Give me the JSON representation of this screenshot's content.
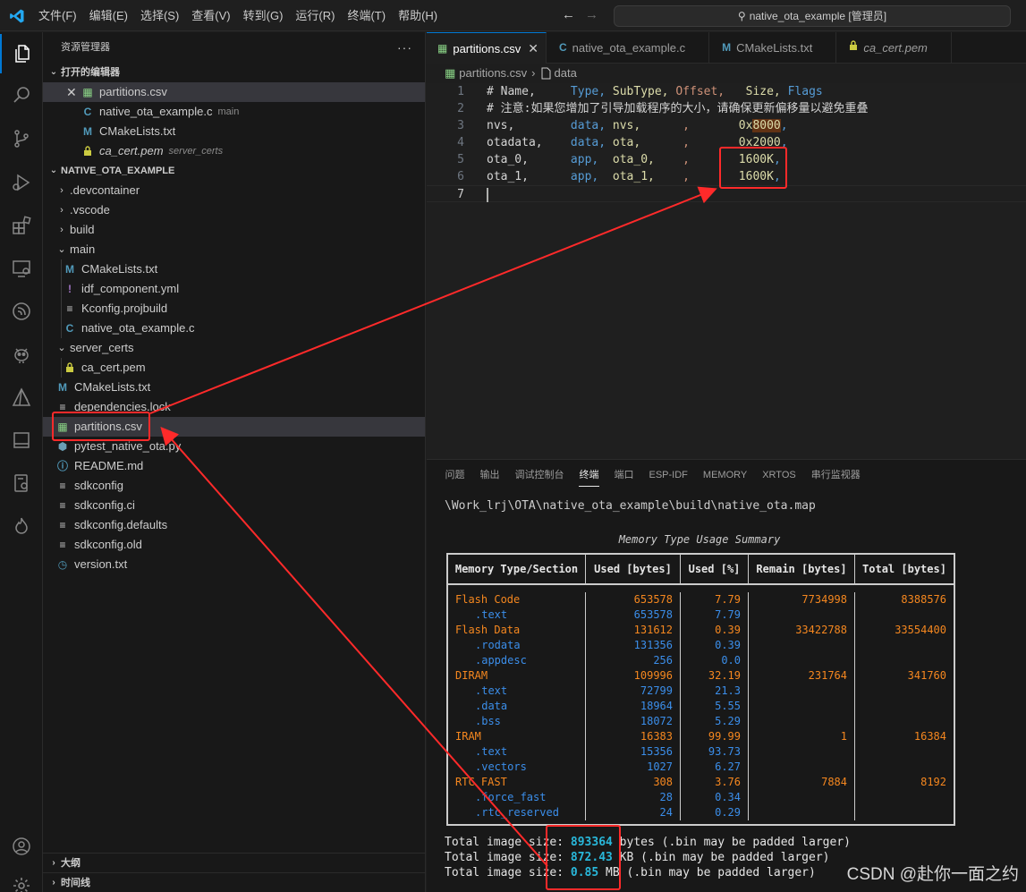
{
  "titlebar": {
    "menu": [
      "文件(F)",
      "编辑(E)",
      "选择(S)",
      "查看(V)",
      "转到(G)",
      "运行(R)",
      "终端(T)",
      "帮助(H)"
    ],
    "search_text": "native_ota_example [管理员]"
  },
  "activity_icons": [
    "explorer-icon",
    "search-icon",
    "source-control-icon",
    "run-debug-icon",
    "extensions-icon",
    "remote-explorer-icon",
    "esp-idf-icon",
    "platformio-icon",
    "cmake-icon",
    "terminal-icon",
    "device-icon",
    "flame-icon",
    "account-icon",
    "manage-icon"
  ],
  "sidebar": {
    "title": "资源管理器",
    "open_editors_title": "打开的编辑器",
    "open_editors": [
      {
        "name": "partitions.csv",
        "icon": "csv",
        "desc": ""
      },
      {
        "name": "native_ota_example.c",
        "icon": "c",
        "desc": "main"
      },
      {
        "name": "CMakeLists.txt",
        "icon": "m",
        "desc": ""
      },
      {
        "name": "ca_cert.pem",
        "icon": "lock",
        "desc": "server_certs"
      }
    ],
    "project_title": "NATIVE_OTA_EXAMPLE",
    "tree": [
      {
        "name": ".devcontainer",
        "type": "folder",
        "depth": 0,
        "expanded": false
      },
      {
        "name": ".vscode",
        "type": "folder",
        "depth": 0,
        "expanded": false
      },
      {
        "name": "build",
        "type": "folder",
        "depth": 0,
        "expanded": false
      },
      {
        "name": "main",
        "type": "folder",
        "depth": 0,
        "expanded": true
      },
      {
        "name": "CMakeLists.txt",
        "type": "m",
        "depth": 1
      },
      {
        "name": "idf_component.yml",
        "type": "excl",
        "depth": 1
      },
      {
        "name": "Kconfig.projbuild",
        "type": "lines",
        "depth": 1
      },
      {
        "name": "native_ota_example.c",
        "type": "c",
        "depth": 1
      },
      {
        "name": "server_certs",
        "type": "folder",
        "depth": 0,
        "expanded": true
      },
      {
        "name": "ca_cert.pem",
        "type": "lock",
        "depth": 1
      },
      {
        "name": "CMakeLists.txt",
        "type": "m",
        "depth": 0
      },
      {
        "name": "dependencies.lock",
        "type": "lines",
        "depth": 0
      },
      {
        "name": "partitions.csv",
        "type": "csv",
        "depth": 0,
        "selected": true
      },
      {
        "name": "pytest_native_ota.py",
        "type": "py",
        "depth": 0
      },
      {
        "name": "README.md",
        "type": "info",
        "depth": 0
      },
      {
        "name": "sdkconfig",
        "type": "lines",
        "depth": 0
      },
      {
        "name": "sdkconfig.ci",
        "type": "lines",
        "depth": 0
      },
      {
        "name": "sdkconfig.defaults",
        "type": "lines",
        "depth": 0
      },
      {
        "name": "sdkconfig.old",
        "type": "lines",
        "depth": 0
      },
      {
        "name": "version.txt",
        "type": "clock",
        "depth": 0
      }
    ],
    "outline_title": "大纲",
    "timeline_title": "时间线"
  },
  "tabs": [
    {
      "name": "partitions.csv",
      "icon": "csv",
      "active": true
    },
    {
      "name": "native_ota_example.c",
      "icon": "c"
    },
    {
      "name": "CMakeLists.txt",
      "icon": "m"
    },
    {
      "name": "ca_cert.pem",
      "icon": "lock",
      "italic": true
    }
  ],
  "breadcrumb": {
    "file": "partitions.csv",
    "node": "data"
  },
  "code_lines": [
    [
      [
        "# Name,     ",
        "w"
      ],
      [
        "Type, ",
        "b"
      ],
      [
        "SubType, ",
        "y"
      ],
      [
        "Offset,   ",
        "o"
      ],
      [
        "Size, ",
        "y"
      ],
      [
        "Flags",
        "b"
      ]
    ],
    [
      [
        "# 注意:如果您增加了引导加载程序的大小，请确保更新偏移量以避免重叠",
        "w"
      ]
    ],
    [
      [
        "nvs,        ",
        "w"
      ],
      [
        "data, ",
        "b"
      ],
      [
        "nvs,      ",
        "y"
      ],
      [
        ",       ",
        "o"
      ],
      [
        "0x",
        "y"
      ],
      [
        "8000",
        "hl"
      ],
      [
        ",",
        "b"
      ]
    ],
    [
      [
        "otadata,    ",
        "w"
      ],
      [
        "data, ",
        "b"
      ],
      [
        "ota,      ",
        "y"
      ],
      [
        ",       ",
        "o"
      ],
      [
        "0x2000",
        "y"
      ],
      [
        ",",
        "b"
      ]
    ],
    [
      [
        "ota_0,      ",
        "w"
      ],
      [
        "app,  ",
        "b"
      ],
      [
        "ota_0,    ",
        "y"
      ],
      [
        ",       ",
        "o"
      ],
      [
        "1600K",
        "y"
      ],
      [
        ",",
        "b"
      ]
    ],
    [
      [
        "ota_1,      ",
        "w"
      ],
      [
        "app,  ",
        "b"
      ],
      [
        "ota_1,    ",
        "y"
      ],
      [
        ",       ",
        "o"
      ],
      [
        "1600K",
        "y"
      ],
      [
        ",",
        "b"
      ]
    ],
    []
  ],
  "panel": {
    "tabs": [
      "问题",
      "输出",
      "调试控制台",
      "终端",
      "端口",
      "ESP-IDF",
      "MEMORY",
      "XRTOS",
      "串行监视器"
    ],
    "active_tab": 3,
    "map_path": "\\Work_lrj\\OTA\\native_ota_example\\build\\native_ota.map",
    "summary_title": "Memory Type Usage Summary",
    "table_headers": [
      "Memory Type/Section",
      "Used [bytes]",
      "Used [%]",
      "Remain [bytes]",
      "Total [bytes]"
    ],
    "table_rows": [
      {
        "name": "Flash Code",
        "sub": false,
        "used": "653578",
        "pct": "7.79",
        "remain": "7734998",
        "total": "8388576"
      },
      {
        "name": ".text",
        "sub": true,
        "used": "653578",
        "pct": "7.79",
        "remain": "",
        "total": ""
      },
      {
        "name": "Flash Data",
        "sub": false,
        "used": "131612",
        "pct": "0.39",
        "remain": "33422788",
        "total": "33554400"
      },
      {
        "name": ".rodata",
        "sub": true,
        "used": "131356",
        "pct": "0.39",
        "remain": "",
        "total": ""
      },
      {
        "name": ".appdesc",
        "sub": true,
        "used": "256",
        "pct": "0.0",
        "remain": "",
        "total": ""
      },
      {
        "name": "DIRAM",
        "sub": false,
        "used": "109996",
        "pct": "32.19",
        "remain": "231764",
        "total": "341760"
      },
      {
        "name": ".text",
        "sub": true,
        "used": "72799",
        "pct": "21.3",
        "remain": "",
        "total": ""
      },
      {
        "name": ".data",
        "sub": true,
        "used": "18964",
        "pct": "5.55",
        "remain": "",
        "total": ""
      },
      {
        "name": ".bss",
        "sub": true,
        "used": "18072",
        "pct": "5.29",
        "remain": "",
        "total": ""
      },
      {
        "name": "IRAM",
        "sub": false,
        "used": "16383",
        "pct": "99.99",
        "remain": "1",
        "total": "16384"
      },
      {
        "name": ".text",
        "sub": true,
        "used": "15356",
        "pct": "93.73",
        "remain": "",
        "total": ""
      },
      {
        "name": ".vectors",
        "sub": true,
        "used": "1027",
        "pct": "6.27",
        "remain": "",
        "total": ""
      },
      {
        "name": "RTC FAST",
        "sub": false,
        "used": "308",
        "pct": "3.76",
        "remain": "7884",
        "total": "8192"
      },
      {
        "name": ".force_fast",
        "sub": true,
        "used": "28",
        "pct": "0.34",
        "remain": "",
        "total": ""
      },
      {
        "name": ".rtc_reserved",
        "sub": true,
        "used": "24",
        "pct": "0.29",
        "remain": "",
        "total": ""
      }
    ],
    "totals": [
      {
        "prefix": "Total image size: ",
        "value": "893364",
        "suffix": " bytes (.bin may be padded larger)"
      },
      {
        "prefix": "Total image size: ",
        "value": "872.43",
        "suffix": " KB (.bin may be padded larger)"
      },
      {
        "prefix": "Total image size: ",
        "value": "0.85",
        "suffix": " MB (.bin may be padded larger)"
      }
    ]
  },
  "watermark": "CSDN @赴你一面之约",
  "colors": {
    "accent": "#0078d4",
    "annotation": "#ff2a2a",
    "terminal_orange": "#f5871f",
    "terminal_blue": "#3b8eea",
    "terminal_cyan": "#29b8db"
  }
}
